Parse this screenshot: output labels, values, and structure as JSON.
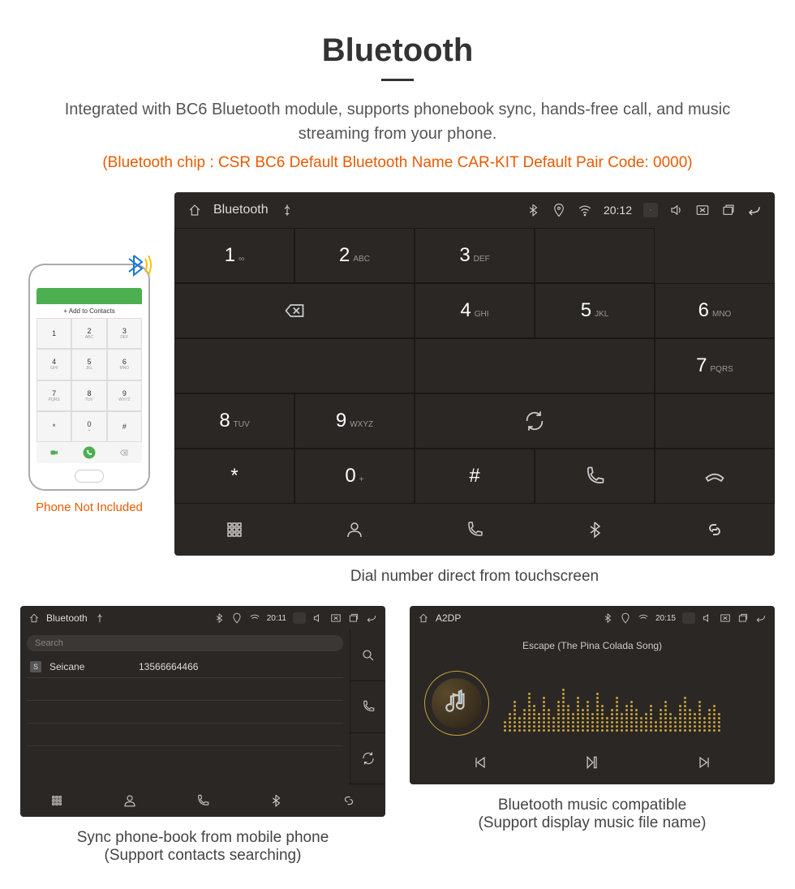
{
  "page": {
    "title": "Bluetooth",
    "desc": "Integrated with BC6 Bluetooth module, supports phonebook sync, hands-free call, and music streaming from your phone.",
    "subdesc": "(Bluetooth chip : CSR BC6    Default Bluetooth Name CAR-KIT    Default Pair Code: 0000)"
  },
  "phone": {
    "add_to_contacts": "Add to Contacts",
    "caption": "Phone Not Included",
    "keys": [
      "1",
      "2",
      "3",
      "4",
      "5",
      "6",
      "7",
      "8",
      "9",
      "*",
      "0",
      "#"
    ],
    "subs": [
      "",
      "ABC",
      "DEF",
      "GHI",
      "JKL",
      "MNO",
      "PQRS",
      "TUV",
      "WXYZ",
      "",
      "+",
      ""
    ]
  },
  "dialer": {
    "status_title": "Bluetooth",
    "time": "20:12",
    "keys": [
      {
        "num": "1",
        "sub": "∞"
      },
      {
        "num": "2",
        "sub": "ABC"
      },
      {
        "num": "3",
        "sub": "DEF"
      },
      {
        "num": "4",
        "sub": "GHI"
      },
      {
        "num": "5",
        "sub": "JKL"
      },
      {
        "num": "6",
        "sub": "MNO"
      },
      {
        "num": "7",
        "sub": "PQRS"
      },
      {
        "num": "8",
        "sub": "TUV"
      },
      {
        "num": "9",
        "sub": "WXYZ"
      },
      {
        "num": "*",
        "sub": ""
      },
      {
        "num": "0",
        "sub": "+"
      },
      {
        "num": "#",
        "sub": ""
      }
    ],
    "caption": "Dial number direct from touchscreen"
  },
  "contacts": {
    "status_title": "Bluetooth",
    "time": "20:11",
    "search_placeholder": "Search",
    "items": [
      {
        "initial": "S",
        "name": "Seicane",
        "number": "13566664466"
      }
    ],
    "caption": "Sync phone-book from mobile phone",
    "caption_sub": "(Support contacts searching)"
  },
  "music": {
    "status_title": "A2DP",
    "time": "20:15",
    "track": "Escape (The Pina Colada Song)",
    "caption": "Bluetooth music compatible",
    "caption_sub": "(Support display music file name)",
    "eq_heights": [
      3,
      5,
      8,
      4,
      6,
      10,
      7,
      5,
      9,
      6,
      4,
      8,
      11,
      7,
      5,
      9,
      6,
      8,
      5,
      10,
      7,
      4,
      6,
      9,
      5,
      7,
      8,
      6,
      4,
      5,
      7,
      3,
      6,
      8,
      5,
      4,
      7,
      9,
      6,
      5,
      8,
      4,
      6,
      7,
      5
    ]
  }
}
